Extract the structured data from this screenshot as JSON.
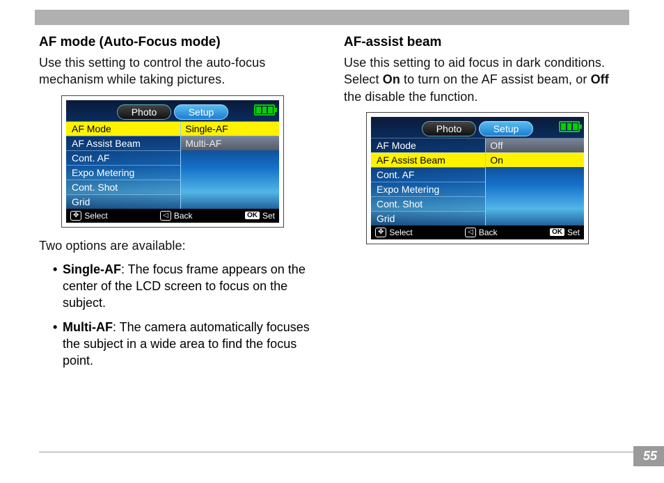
{
  "page_number": "55",
  "left": {
    "heading": "AF mode (Auto-Focus mode)",
    "intro": "Use this setting to control the auto-focus mechanism while taking pictures.",
    "after_image": "Two options are available:",
    "bullets": [
      {
        "term": "Single-AF",
        "desc": ": The focus frame appears on the center of the LCD screen to focus on the subject."
      },
      {
        "term": "Multi-AF",
        "desc": ": The camera automatically focuses the subject in a wide area to find the focus point."
      }
    ],
    "lcd": {
      "tabs": {
        "photo": "Photo",
        "setup": "Setup"
      },
      "menu": [
        "AF Mode",
        "AF Assist Beam",
        "Cont. AF",
        "Expo Metering",
        "Cont. Shot",
        "Grid"
      ],
      "menu_selected_index": 0,
      "submenu": [
        "Single-AF",
        "Multi-AF"
      ],
      "submenu_selected_index": 0,
      "footer": {
        "select": "Select",
        "back": "Back",
        "set": "Set",
        "ok": "OK"
      }
    }
  },
  "right": {
    "heading": "AF-assist beam",
    "intro_parts": {
      "a": "Use this setting to aid focus in dark condi­tions. Select ",
      "on": "On",
      "b": " to turn on the AF assist beam, or ",
      "off": "Off",
      "c": " the disable the function."
    },
    "lcd": {
      "tabs": {
        "photo": "Photo",
        "setup": "Setup"
      },
      "menu": [
        "AF Mode",
        "AF Assist Beam",
        "Cont. AF",
        "Expo Metering",
        "Cont. Shot",
        "Grid"
      ],
      "menu_selected_index": 1,
      "submenu": [
        "Off",
        "On"
      ],
      "submenu_selected_index": 1,
      "footer": {
        "select": "Select",
        "back": "Back",
        "set": "Set",
        "ok": "OK"
      }
    }
  }
}
